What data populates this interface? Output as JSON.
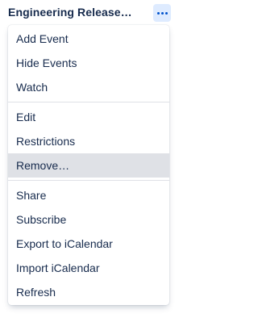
{
  "calendar": {
    "title": "Engineering Release…",
    "more_icon": "ellipsis-icon",
    "accent": "#0052CC"
  },
  "menu": {
    "groups": [
      [
        "Add Event",
        "Hide Events",
        "Watch"
      ],
      [
        "Edit",
        "Restrictions",
        "Remove…"
      ],
      [
        "Share",
        "Subscribe",
        "Export to iCalendar",
        "Import iCalendar",
        "Refresh"
      ]
    ],
    "highlighted_item": "Remove…"
  }
}
